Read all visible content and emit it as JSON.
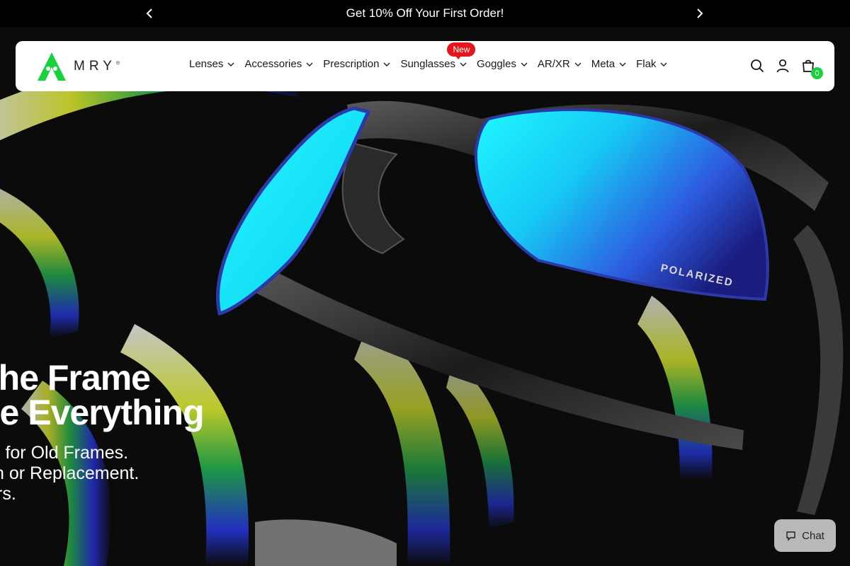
{
  "announcement": {
    "text": "Get 10% Off Your First Order!",
    "prev_icon": "chevron-left-icon",
    "next_icon": "chevron-right-icon"
  },
  "brand": {
    "name": "MRY",
    "reg": "®",
    "accent": "#17d13d"
  },
  "nav": {
    "items": [
      {
        "label": "Lenses"
      },
      {
        "label": "Accessories"
      },
      {
        "label": "Prescription"
      },
      {
        "label": "Sunglasses",
        "badge": "New"
      },
      {
        "label": "Goggles"
      },
      {
        "label": "AR/XR"
      },
      {
        "label": "Meta"
      },
      {
        "label": "Flak"
      }
    ],
    "badge_color": "#e4161b"
  },
  "tools": {
    "search_icon": "search-icon",
    "account_icon": "user-icon",
    "cart_icon": "bag-icon",
    "cart_count": "0"
  },
  "hero": {
    "headline_line1": "the Frame",
    "headline_line2": "ge Everything",
    "sub_line1": "s for Old Frames.",
    "sub_line2": "n or Replacement.",
    "sub_line3": "rs.",
    "lens_text": "POLARIZED"
  },
  "chat": {
    "label": "Chat",
    "icon": "chat-icon"
  }
}
